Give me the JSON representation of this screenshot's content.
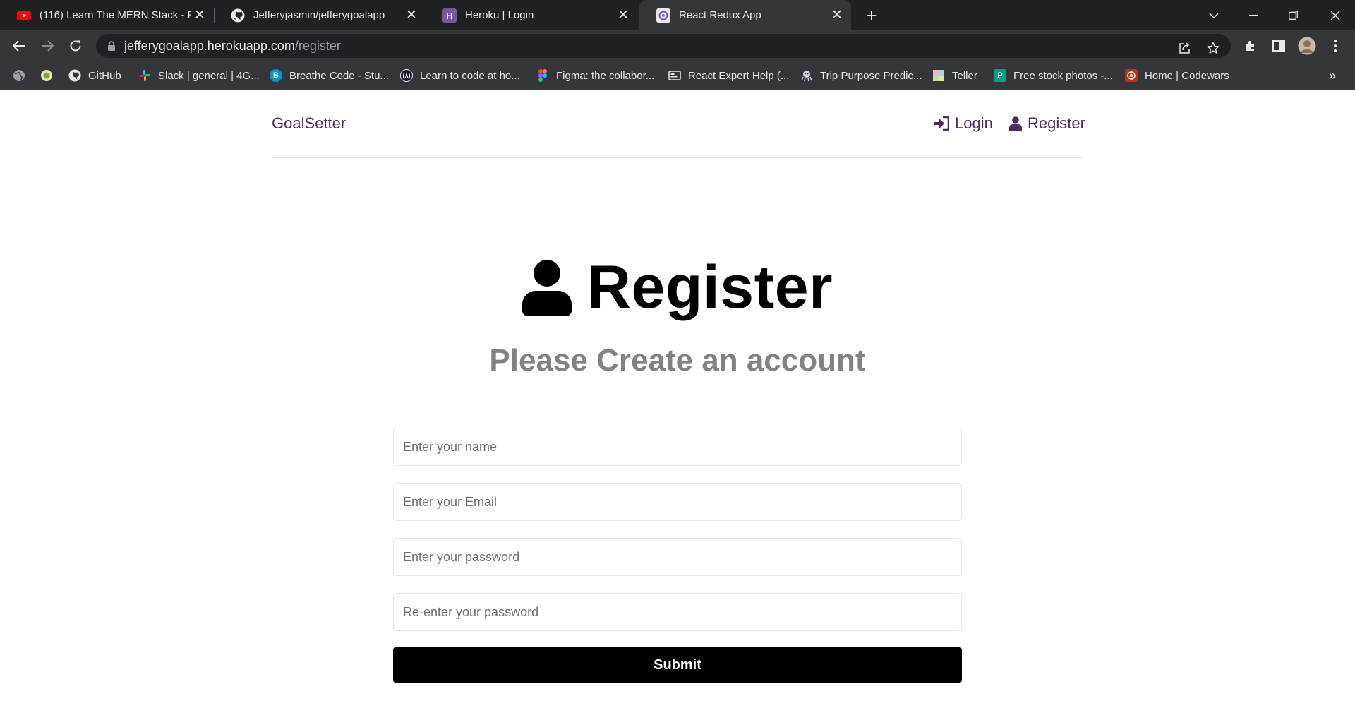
{
  "browser": {
    "tabs": [
      {
        "title": "(116) Learn The MERN Stack - Re",
        "icon": "youtube-icon"
      },
      {
        "title": "Jefferyjasmin/jefferygoalapp",
        "icon": "github-icon"
      },
      {
        "title": "Heroku | Login",
        "icon": "heroku-icon"
      },
      {
        "title": "React Redux App",
        "icon": "redux-icon",
        "active": true
      }
    ],
    "url_host": "jefferygoalapp.herokuapp.com",
    "url_path": "/register",
    "bookmarks": [
      {
        "label": "GitHub",
        "icon": "github-icon"
      },
      {
        "label": "Slack | general | 4G...",
        "icon": "slack-icon"
      },
      {
        "label": "Breathe Code - Stu...",
        "icon": "breathecode-icon"
      },
      {
        "label": "Learn to code at ho...",
        "icon": "code-icon"
      },
      {
        "label": "Figma: the collabor...",
        "icon": "figma-icon"
      },
      {
        "label": "React Expert Help (...",
        "icon": "card-icon"
      },
      {
        "label": "Trip Purpose Predic...",
        "icon": "octopus-icon"
      },
      {
        "label": "Teller",
        "icon": "teller-icon"
      },
      {
        "label": "Free stock photos -...",
        "icon": "pexels-icon"
      },
      {
        "label": "Home | Codewars",
        "icon": "codewars-icon"
      }
    ],
    "overflow": "»"
  },
  "header": {
    "logo": "GoalSetter",
    "login": "Login",
    "register": "Register"
  },
  "main": {
    "title": "Register",
    "subtitle": "Please Create an account",
    "form": {
      "name_placeholder": "Enter your name",
      "email_placeholder": "Enter your Email",
      "password_placeholder": "Enter your password",
      "password2_placeholder": "Re-enter your password",
      "submit": "Submit"
    }
  },
  "colors": {
    "accent": "#4b2a6e",
    "button": "#000000",
    "subtitle": "#828282"
  }
}
